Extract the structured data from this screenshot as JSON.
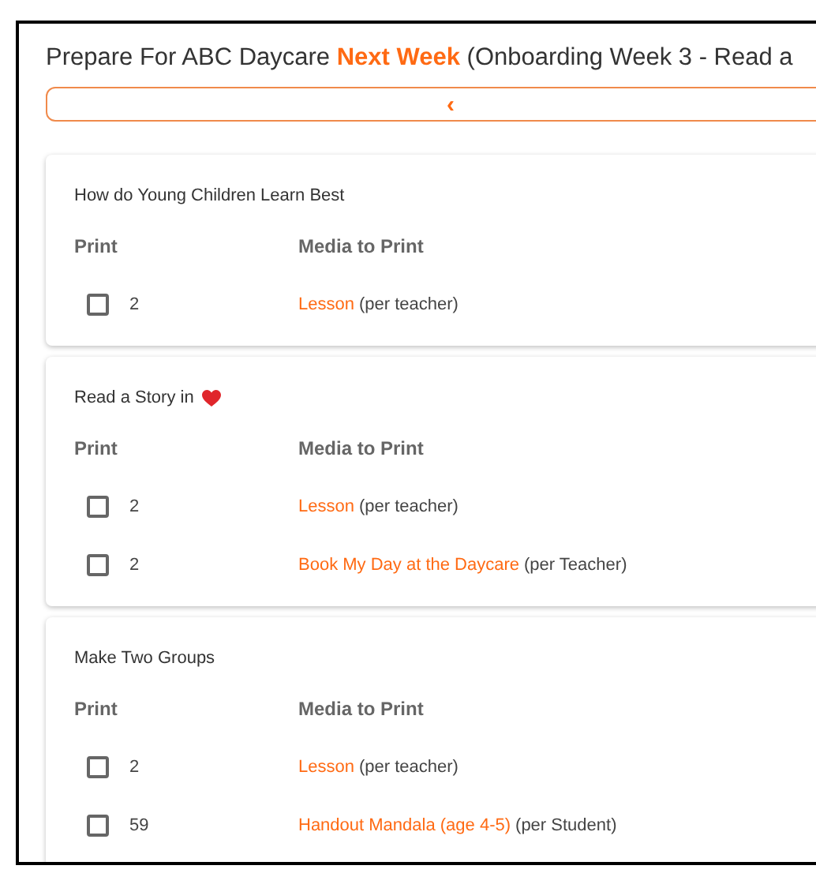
{
  "title": [
    {
      "text": "Prepare For ABC Daycare ",
      "highlight": false
    },
    {
      "text": "Next Week",
      "highlight": true
    },
    {
      "text": " (Onboarding Week 3 - Read a",
      "highlight": false
    }
  ],
  "collapse_button": {
    "label": "‹"
  },
  "sections": [
    {
      "title": "How do Young Children Learn Best",
      "heart": false,
      "columns": [
        "Print",
        "Media to Print"
      ],
      "rows": [
        {
          "checked": false,
          "count": "2",
          "media": "Lesson",
          "per": "(per teacher)"
        }
      ]
    },
    {
      "title": "Read a Story in",
      "heart": true,
      "columns": [
        "Print",
        "Media to Print"
      ],
      "rows": [
        {
          "checked": false,
          "count": "2",
          "media": "Lesson",
          "per": "(per teacher)"
        },
        {
          "checked": false,
          "count": "2",
          "media": "Book My Day at the Daycare",
          "per": "(per Teacher)"
        }
      ]
    },
    {
      "title": "Make Two Groups",
      "heart": false,
      "columns": [
        "Print",
        "Media to Print"
      ],
      "rows": [
        {
          "checked": false,
          "count": "2",
          "media": "Lesson",
          "per": "(per teacher)"
        },
        {
          "checked": false,
          "count": "59",
          "media": "Handout Mandala (age 4-5)",
          "per": "(per Student)"
        }
      ]
    }
  ]
}
